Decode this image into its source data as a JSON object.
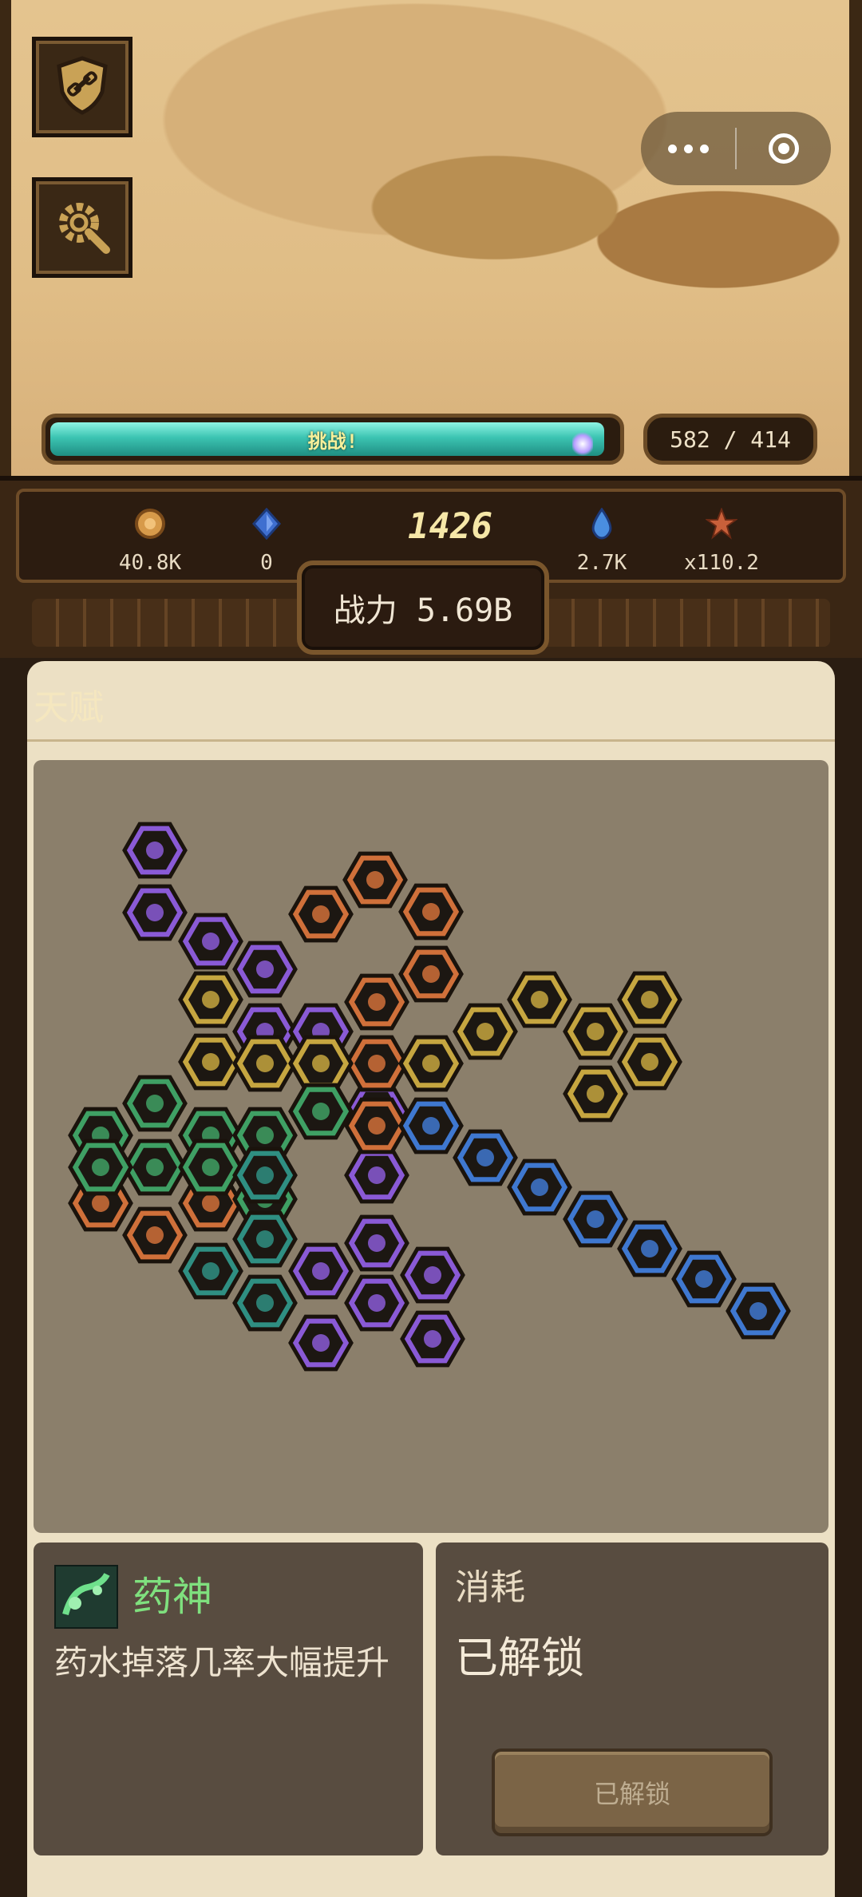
{
  "header": {
    "progress_label": "挑战!",
    "progress_fraction": 0.98,
    "stage_counter": "582 / 414"
  },
  "side_buttons": [
    {
      "icon": "shield-link-icon"
    },
    {
      "icon": "settings-wrench-icon"
    }
  ],
  "mini_program_capsule": {
    "more_icon": "more-dots-icon",
    "close_icon": "record-circle-icon"
  },
  "resources": [
    {
      "icon": "coin-icon",
      "value": "40.8K",
      "color": "#d79a4a"
    },
    {
      "icon": "gem-icon",
      "value": "0",
      "color": "#3f6fd0"
    },
    {
      "icon": "water-drop-icon",
      "value": "2.7K",
      "color": "#4a8ee0"
    },
    {
      "icon": "star-icon",
      "value": "x110.2",
      "color": "#c8603a"
    }
  ],
  "level": "1426",
  "power": "战力 5.69B",
  "panel": {
    "title": "天赋",
    "colors": {
      "purple": "#8a5ad6",
      "orange": "#d0703a",
      "yellow": "#c6a640",
      "green": "#3fa064",
      "blue": "#3f78d0",
      "teal": "#2f8f82"
    }
  },
  "selected_talent": {
    "icon": "potion-god-icon",
    "name": "药神",
    "description": "药水掉落几率大幅提升"
  },
  "cost": {
    "label": "消耗",
    "value": "已解锁",
    "button": "已解锁"
  }
}
